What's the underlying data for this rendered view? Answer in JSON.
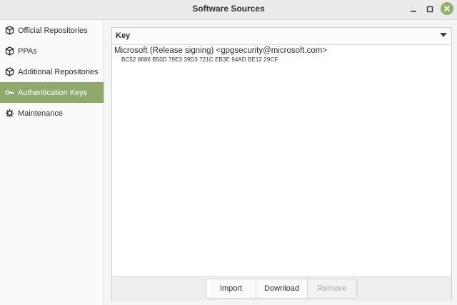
{
  "window": {
    "title": "Software Sources"
  },
  "sidebar": {
    "items": [
      {
        "label": "Official Repositories",
        "icon": "package-icon",
        "active": false
      },
      {
        "label": "PPAs",
        "icon": "package-icon",
        "active": false
      },
      {
        "label": "Additional Repositories",
        "icon": "package-icon",
        "active": false
      },
      {
        "label": "Authentication Keys",
        "icon": "key-icon",
        "active": true
      },
      {
        "label": "Maintenance",
        "icon": "gear-icon",
        "active": false
      }
    ]
  },
  "keys_panel": {
    "column_header": "Key",
    "keys": [
      {
        "name": "Microsoft (Release signing) <gpgsecurity@microsoft.com>",
        "fingerprint": "BC52 8686 B50D 79E3 39D3  721C EB3E 94AD BE12 29CF"
      }
    ],
    "buttons": {
      "import": "Import",
      "download": "Download",
      "remove": "Remove"
    }
  },
  "colors": {
    "accent": "#8fa86b",
    "close_button": "#8fb369"
  }
}
